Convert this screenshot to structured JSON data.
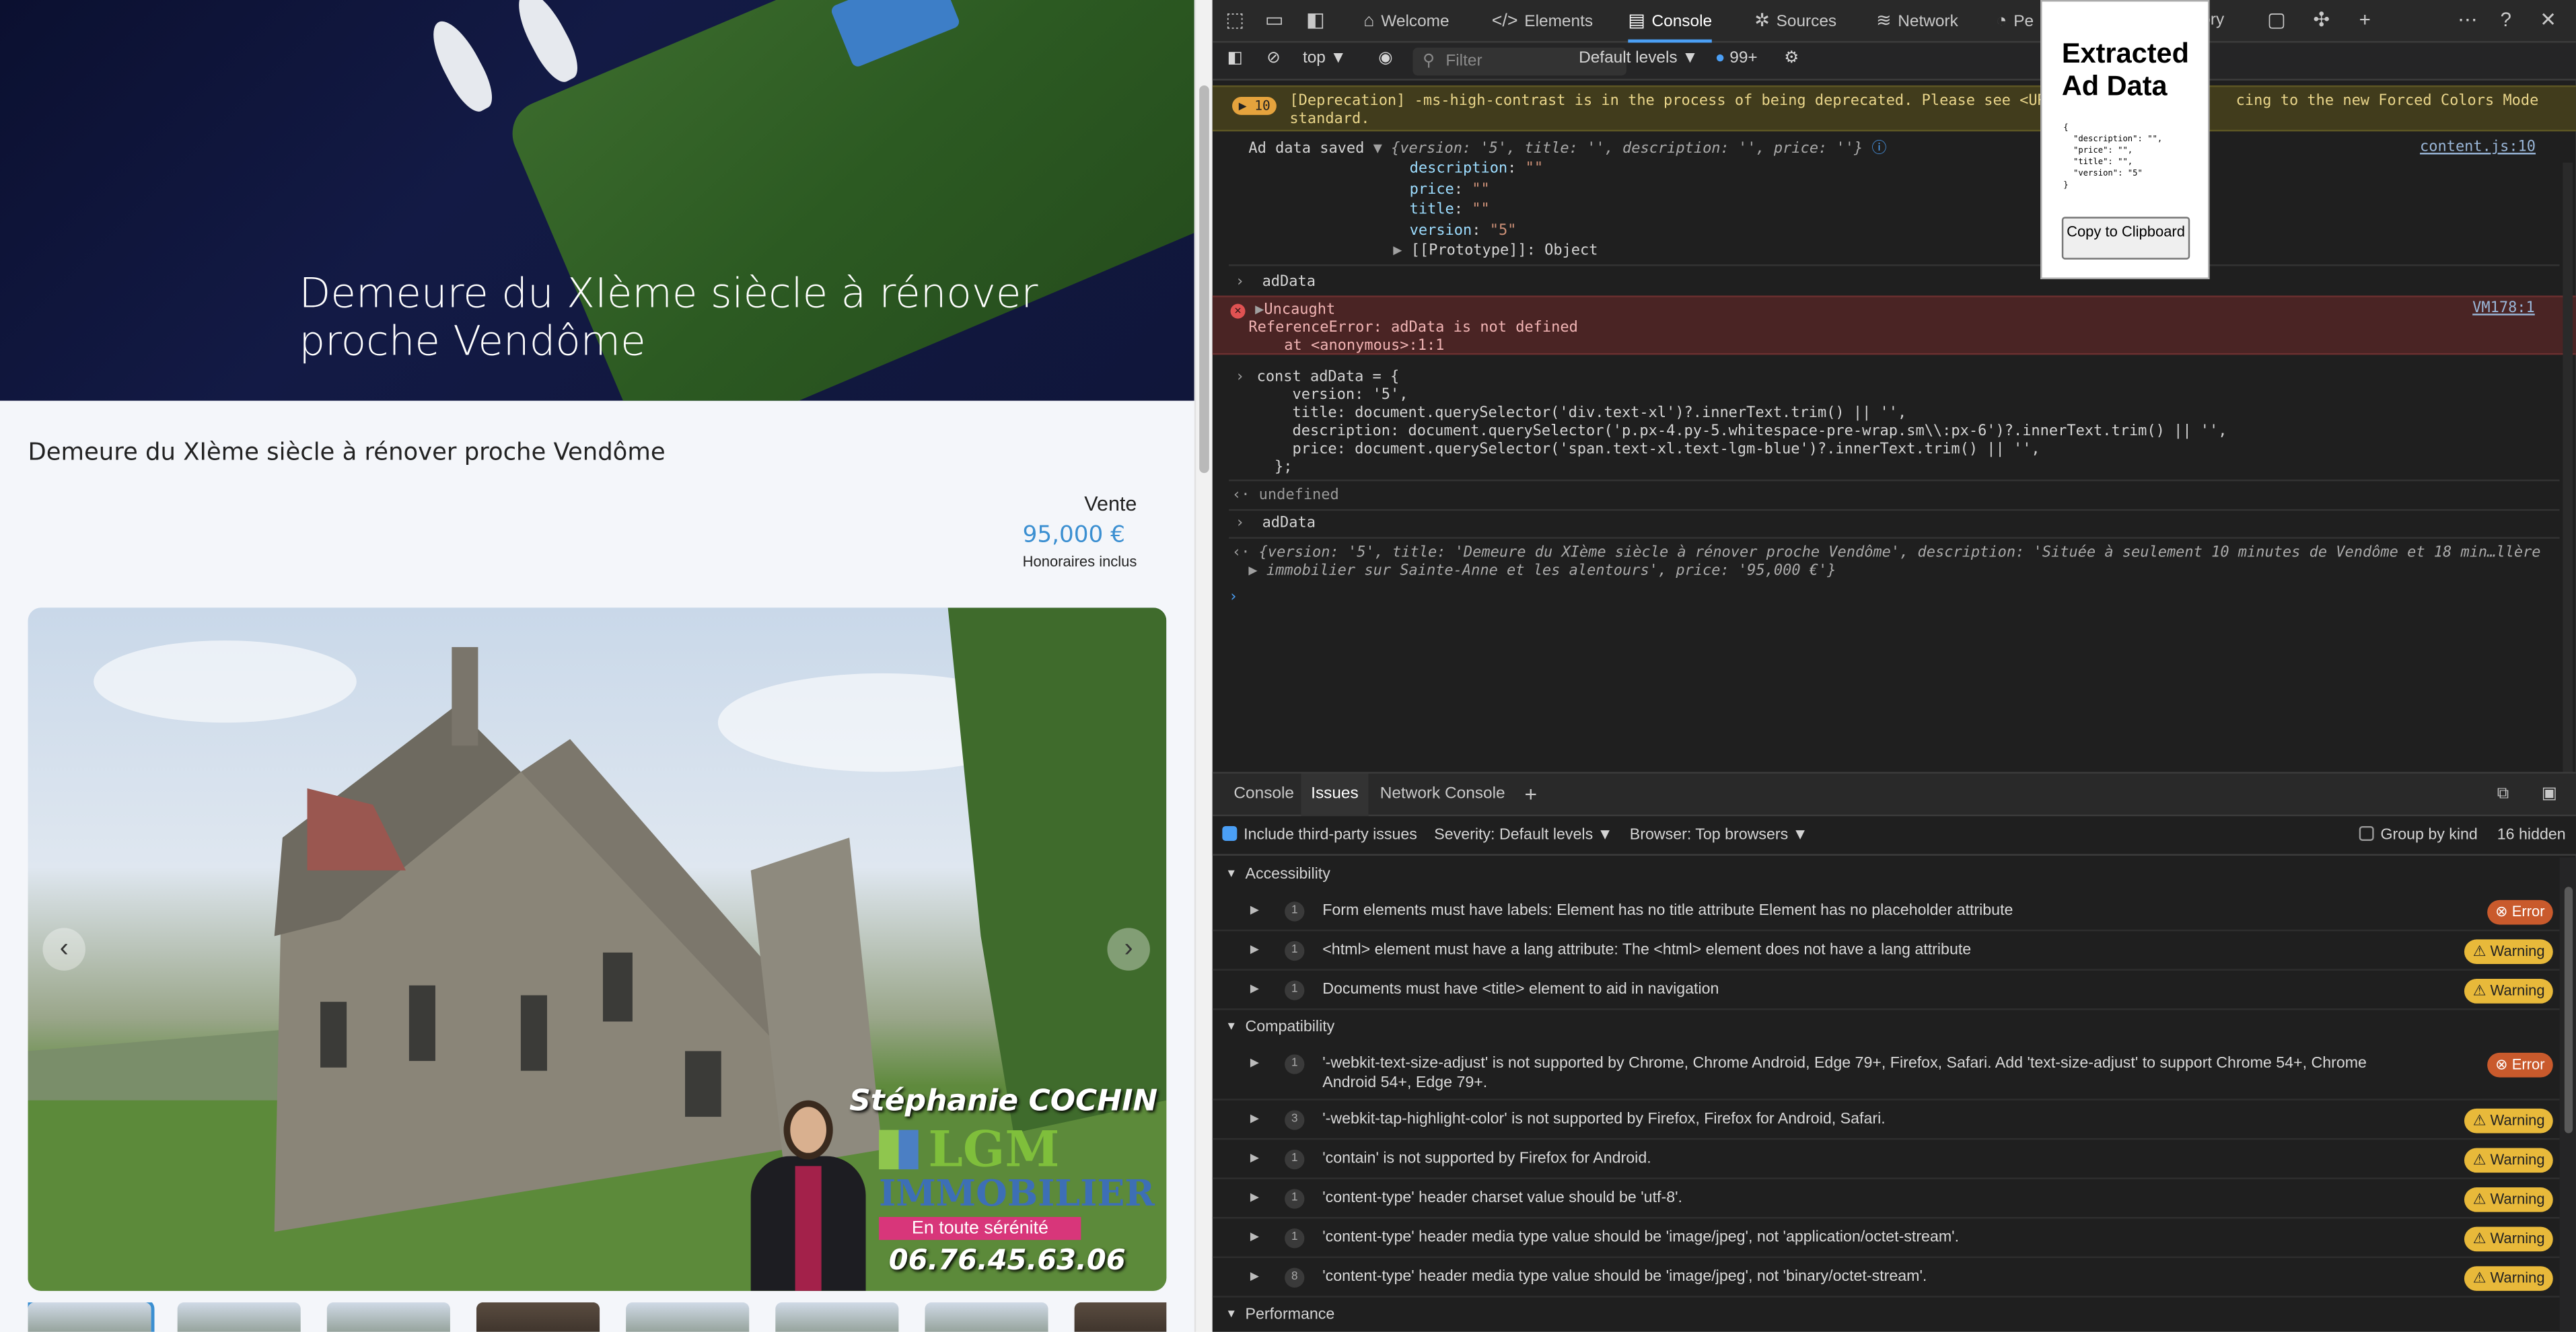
{
  "webpage": {
    "hero_title": "Demeure du XIème siècle à rénover proche Vendôme",
    "page_title": "Demeure du XIème siècle à rénover proche Vendôme",
    "transaction": "Vente",
    "price": "95,000 €",
    "fees_note": "Honoraires inclus",
    "agent_name": "Stéphanie COCHIN",
    "logo_lgm": "LGM",
    "logo_immobilier": "IMMOBILIER",
    "logo_tagline": "En toute sérénité",
    "agent_phone": "06.76.45.63.06"
  },
  "devtools": {
    "tabs": [
      "Welcome",
      "Elements",
      "Console",
      "Sources",
      "Network",
      "Pe",
      "ory"
    ],
    "active_tab": "Console",
    "toolbar": {
      "context": "top",
      "filter_placeholder": "Filter",
      "levels": "Default levels",
      "issues_count": "99+"
    },
    "deprecation": {
      "count": "10",
      "text": "[Deprecation] -ms-high-contrast is in the process of being deprecated. Please see <URL",
      "text_right": "cing to the new Forced Colors Mode",
      "text_line2": "standard."
    },
    "ad_saved_label": "Ad data saved",
    "ad_saved_summary": "{version: '5', title: '', description: '', price: ''}",
    "ad_saved_source": "content.js:10",
    "ad_props": [
      {
        "key": "description",
        "value": "\"\""
      },
      {
        "key": "price",
        "value": "\"\""
      },
      {
        "key": "title",
        "value": "\"\""
      },
      {
        "key": "version",
        "value": "\"5\""
      }
    ],
    "prototype": "[[Prototype]]: Object",
    "cmd1": "adData",
    "error": {
      "label": "Uncaught",
      "message": "ReferenceError: adData is not defined",
      "at": "    at <anonymous>:1:1",
      "source": "VM178:1"
    },
    "code_lines": [
      "const adData = {",
      "    version: '5',",
      "    title: document.querySelector('div.text-xl')?.innerText.trim() || '',",
      "    description: document.querySelector('p.px-4.py-5.whitespace-pre-wrap.sm\\\\:px-6')?.innerText.trim() || '',",
      "    price: document.querySelector('span.text-xl.text-lgm-blue')?.innerText.trim() || '',",
      "  };"
    ],
    "result_undefined": "undefined",
    "cmd2": "adData",
    "result_line1": "{version: '5', title: 'Demeure du XIème siècle à rénover proche Vendôme', description: 'Située à seulement 10 minutes de Vendôme et 18 min…llère",
    "result_line2": "immobilier sur Sainte-Anne et les alentours', price: '95,000 €'}",
    "popup": {
      "title": "Extracted Ad Data",
      "json": "{\n  \"description\": \"\",\n  \"price\": \"\",\n  \"title\": \"\",\n  \"version\": \"5\"\n}",
      "button": "Copy to Clipboard"
    },
    "drawer_tabs": [
      "Console",
      "Issues",
      "Network Console"
    ],
    "drawer_active": "Issues",
    "issues_toolbar": {
      "third_party": "Include third-party issues",
      "severity_label": "Severity:",
      "severity_value": "Default levels",
      "browser_label": "Browser:",
      "browser_value": "Top browsers",
      "group_by_kind": "Group by kind",
      "hidden": "16 hidden"
    },
    "categories": [
      "Accessibility",
      "Compatibility",
      "Performance"
    ],
    "issues_accessibility": [
      {
        "count": "1",
        "text": "Form elements must have labels: Element has no title attribute Element has no placeholder attribute",
        "severity": "Error"
      },
      {
        "count": "1",
        "text": "<html> element must have a lang attribute: The <html> element does not have a lang attribute",
        "severity": "Warning"
      },
      {
        "count": "1",
        "text": "Documents must have <title> element to aid in navigation",
        "severity": "Warning"
      }
    ],
    "issues_compatibility": [
      {
        "count": "1",
        "text": "'-webkit-text-size-adjust' is not supported by Chrome, Chrome Android, Edge 79+, Firefox, Safari. Add 'text-size-adjust' to support Chrome 54+, Chrome Android 54+, Edge 79+.",
        "severity": "Error"
      },
      {
        "count": "3",
        "text": "'-webkit-tap-highlight-color' is not supported by Firefox, Firefox for Android, Safari.",
        "severity": "Warning"
      },
      {
        "count": "1",
        "text": "'contain' is not supported by Firefox for Android.",
        "severity": "Warning"
      },
      {
        "count": "1",
        "text": "'content-type' header charset value should be 'utf-8'.",
        "severity": "Warning"
      },
      {
        "count": "1",
        "text": "'content-type' header media type value should be 'image/jpeg', not 'application/octet-stream'.",
        "severity": "Warning"
      },
      {
        "count": "8",
        "text": "'content-type' header media type value should be 'image/jpeg', not 'binary/octet-stream'.",
        "severity": "Warning"
      }
    ],
    "colors": {
      "error": "#c95a2c",
      "warning": "#e8b93a",
      "accent": "#4b9ff5"
    }
  }
}
